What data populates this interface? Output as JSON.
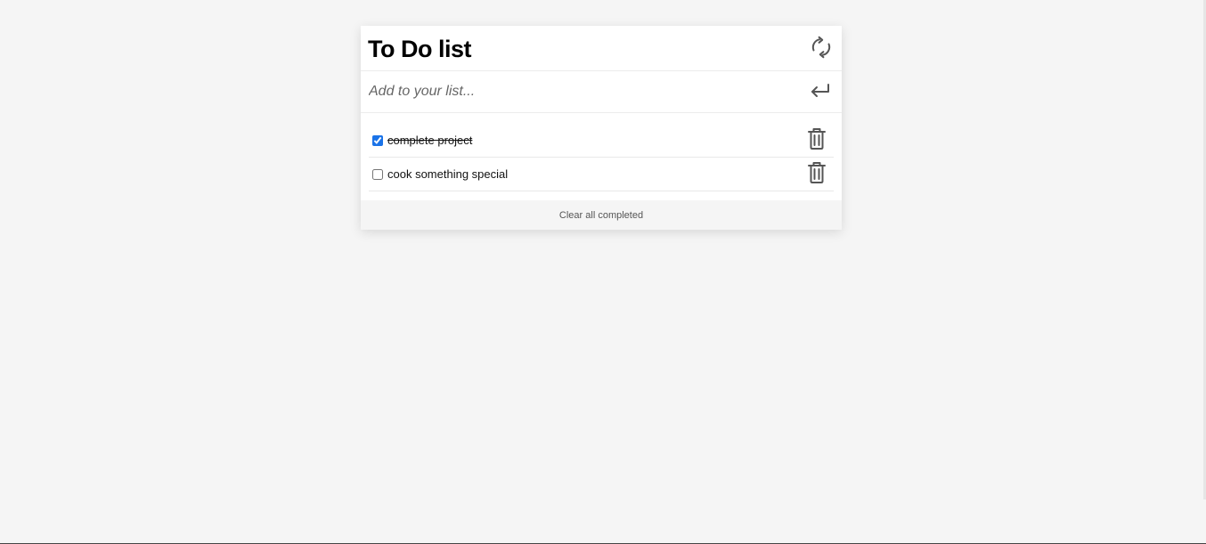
{
  "app": {
    "title": "To Do list"
  },
  "header": {
    "refresh_icon": "refresh-icon"
  },
  "add": {
    "placeholder": "Add to your list...",
    "value": "",
    "submit_icon": "enter-icon"
  },
  "items": [
    {
      "text": "complete project",
      "completed": true,
      "delete_icon": "trash-icon"
    },
    {
      "text": "cook something special",
      "completed": false,
      "delete_icon": "trash-icon"
    }
  ],
  "footer": {
    "clear_label": "Clear all completed"
  },
  "colors": {
    "background": "#f5f5f5",
    "card": "#ffffff",
    "icon": "#555555",
    "checkbox_accent": "#1a73e8"
  }
}
